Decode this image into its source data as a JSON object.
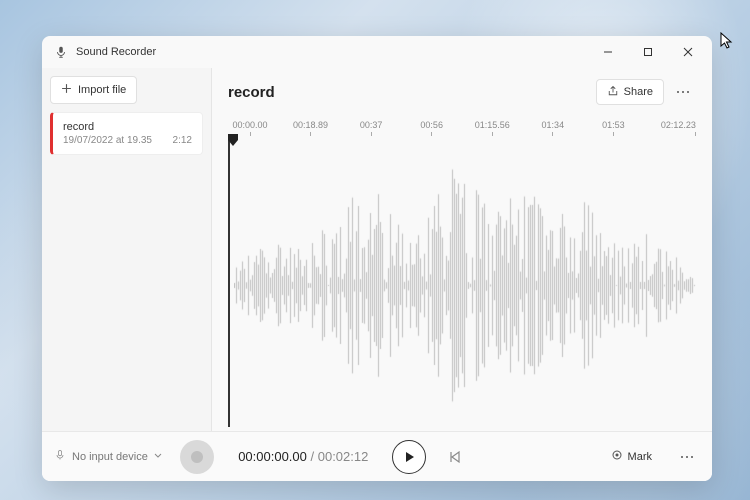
{
  "app": {
    "title": "Sound Recorder"
  },
  "sidebar": {
    "import_label": "Import file",
    "recordings": [
      {
        "name": "record",
        "date": "19/07/2022 at 19.35",
        "duration": "2:12"
      }
    ]
  },
  "main": {
    "title": "record",
    "share_label": "Share",
    "timeline_ticks": [
      "00:00.00",
      "00:18.89",
      "00:37",
      "00:56",
      "01:15.56",
      "01:34",
      "01:53",
      "02:12.23"
    ]
  },
  "footer": {
    "device_label": "No input device",
    "current_time": "00:00:00.00",
    "separator": " / ",
    "total_time": "00:02:12",
    "mark_label": "Mark"
  },
  "icons": {
    "mic": "mic-icon",
    "plus": "plus-icon",
    "share": "share-icon",
    "play": "play-icon",
    "record": "record-icon",
    "skip_back": "skip-back-icon",
    "mark": "mark-icon",
    "more": "more-icon",
    "chevron_down": "chevron-down-icon",
    "minimize": "minimize-icon",
    "maximize": "maximize-icon",
    "close": "close-icon"
  }
}
